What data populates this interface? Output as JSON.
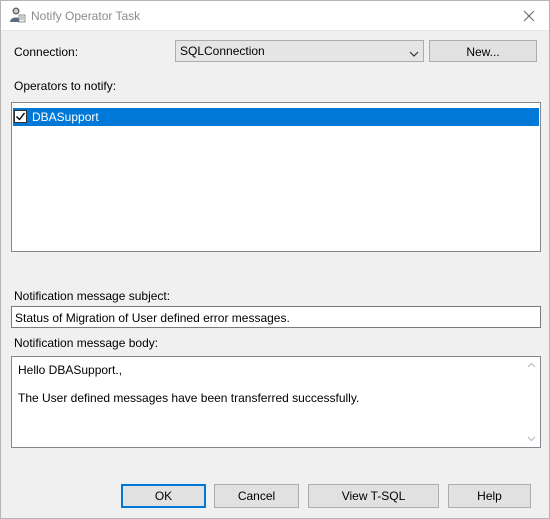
{
  "window": {
    "title": "Notify Operator Task",
    "title_icon": "operator-task-icon"
  },
  "connection": {
    "label": "Connection:",
    "value": "SQLConnection",
    "new_button": "New..."
  },
  "operators": {
    "label": "Operators to notify:",
    "items": [
      {
        "label": "DBASupport",
        "checked": true,
        "selected": true
      }
    ]
  },
  "subject": {
    "label": "Notification message subject:",
    "value": "Status of Migration of User defined error messages."
  },
  "body": {
    "label": "Notification message body:",
    "lines": [
      "Hello DBASupport.,",
      "The User defined messages have been transferred successfully."
    ]
  },
  "buttons": {
    "ok": "OK",
    "cancel": "Cancel",
    "view_tsql": "View T-SQL",
    "help": "Help"
  },
  "colors": {
    "selection": "#0078d7",
    "dialog_bg": "#f0f0f0"
  }
}
